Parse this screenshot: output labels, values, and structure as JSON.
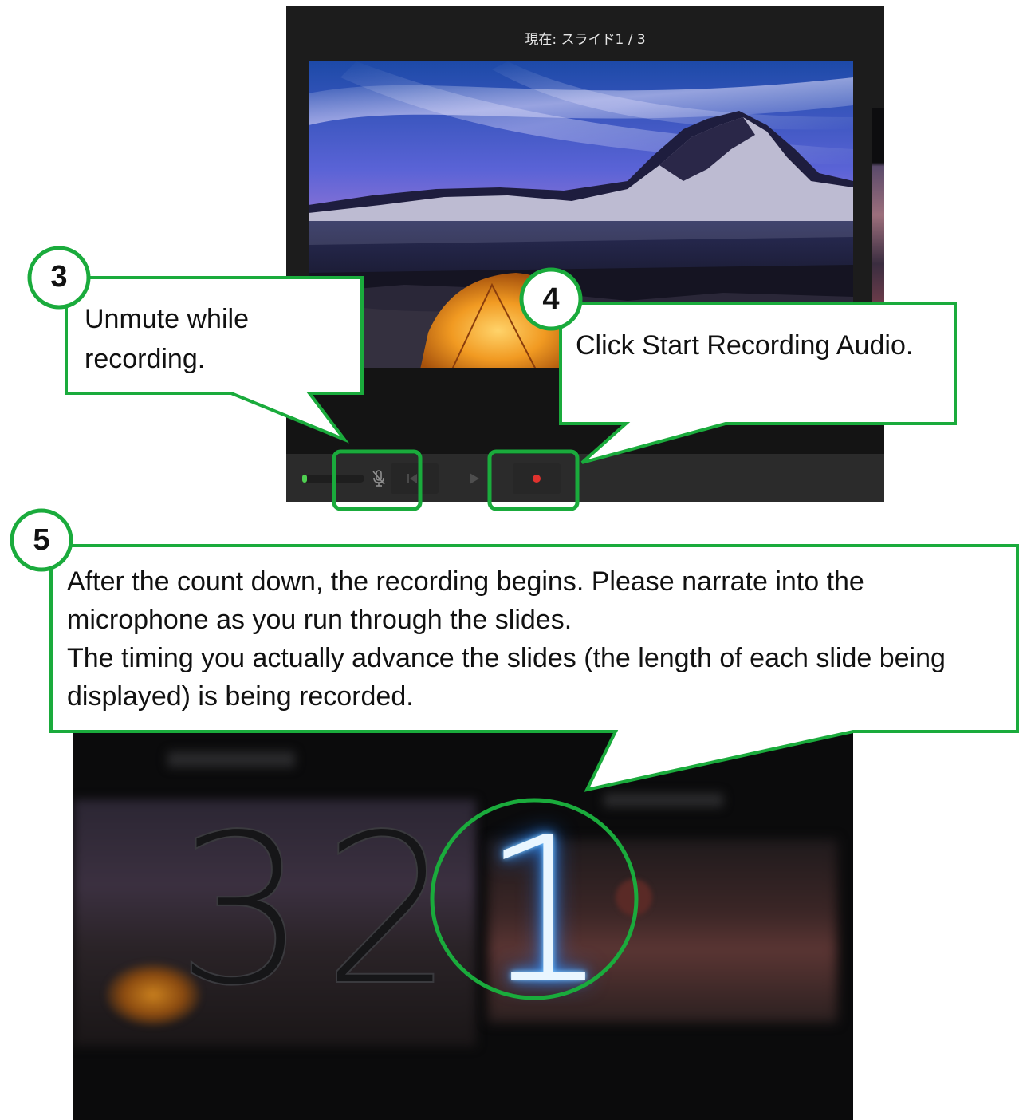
{
  "top_screenshot": {
    "slide_indicator": "現在: スライド1 / 3",
    "toolbar": {
      "mic_icon": "microphone-muted-icon",
      "skip_back_icon": "skip-back-icon",
      "play_icon": "play-icon",
      "record_icon": "record-dot-icon"
    }
  },
  "countdown": {
    "digits": [
      "3",
      "2",
      "1"
    ],
    "active_digit": "1"
  },
  "callouts": [
    {
      "number": "3",
      "text": "Unmute while recording."
    },
    {
      "number": "4",
      "text": "Click Start Recording Audio."
    },
    {
      "number": "5",
      "text_lines": [
        "After the count down, the recording begins. Please narrate into the microphone as you run through the slides.",
        "The timing you actually advance the slides (the length of each slide being displayed) is being recorded."
      ]
    }
  ],
  "colors": {
    "callout_green": "#1aab3c",
    "record_red": "#e0322e",
    "level_green": "#4fd051",
    "countdown_glow": "#3d9bff"
  }
}
